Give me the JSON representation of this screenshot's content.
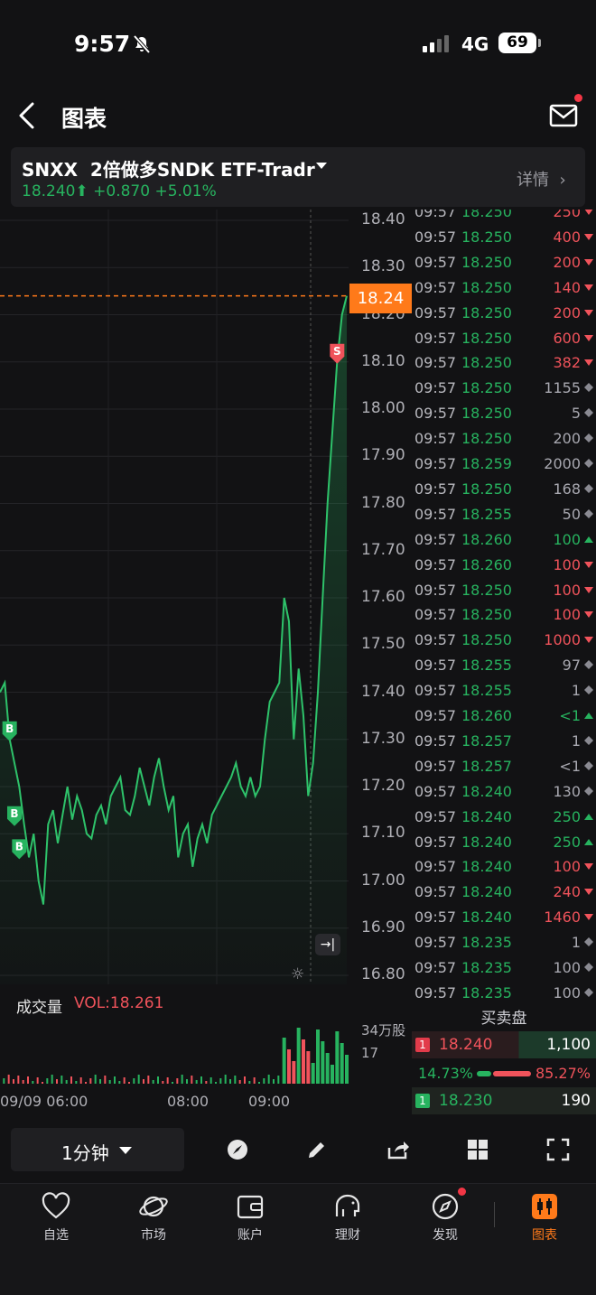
{
  "status_bar": {
    "time": "9:57",
    "network": "4G",
    "battery": "69"
  },
  "header": {
    "title": "图表"
  },
  "stock": {
    "symbol": "SNXX",
    "name": "2倍做多SNDK ETF-Tradr",
    "price": "18.240",
    "change": "+0.870",
    "change_pct": "+5.01%",
    "detail_label": "详情"
  },
  "chart_data": {
    "type": "line",
    "y_ticks": [
      "18.40",
      "18.30",
      "18.20",
      "18.10",
      "18.00",
      "17.90",
      "17.80",
      "17.70",
      "17.60",
      "17.50",
      "17.40",
      "17.30",
      "17.20",
      "17.10",
      "17.00",
      "16.90",
      "16.80"
    ],
    "ylim": [
      16.8,
      18.4
    ],
    "x_ticks": [
      "09/09 06:00",
      "08:00",
      "09:00"
    ],
    "last_price_label": "18.24",
    "series": [
      {
        "values": [
          17.4,
          17.42,
          17.3,
          17.25,
          17.2,
          17.12,
          17.05,
          17.1,
          17.0,
          16.95,
          17.12,
          17.15,
          17.08,
          17.14,
          17.2,
          17.13,
          17.18,
          17.15,
          17.1,
          17.09,
          17.14,
          17.16,
          17.12,
          17.18,
          17.2,
          17.22,
          17.15,
          17.14,
          17.18,
          17.24,
          17.2,
          17.16,
          17.22,
          17.26,
          17.2,
          17.15,
          17.18,
          17.05,
          17.1,
          17.12,
          17.03,
          17.09,
          17.12,
          17.08,
          17.14,
          17.16,
          17.18,
          17.2,
          17.22,
          17.25,
          17.2,
          17.18,
          17.22,
          17.18,
          17.2,
          17.3,
          17.38,
          17.4,
          17.42,
          17.6,
          17.55,
          17.3,
          17.45,
          17.35,
          17.18,
          17.25,
          17.4,
          17.6,
          17.8,
          17.95,
          18.1,
          18.2,
          18.24
        ]
      }
    ],
    "markers": [
      {
        "label": "B",
        "index": 2,
        "value": 17.3
      },
      {
        "label": "B",
        "index": 3,
        "value": 17.12
      },
      {
        "label": "B",
        "index": 4,
        "value": 17.05
      },
      {
        "label": "S",
        "index": 70,
        "value": 18.1
      }
    ]
  },
  "volume": {
    "label": "成交量",
    "vol_value": "VOL:18.261",
    "axis_top": "34万股",
    "axis_mid": "17"
  },
  "trades": [
    {
      "time": "09:57",
      "price": "18.250",
      "vol": "250",
      "dir": "down"
    },
    {
      "time": "09:57",
      "price": "18.250",
      "vol": "400",
      "dir": "down"
    },
    {
      "time": "09:57",
      "price": "18.250",
      "vol": "200",
      "dir": "down"
    },
    {
      "time": "09:57",
      "price": "18.250",
      "vol": "140",
      "dir": "down"
    },
    {
      "time": "09:57",
      "price": "18.250",
      "vol": "200",
      "dir": "down"
    },
    {
      "time": "09:57",
      "price": "18.250",
      "vol": "600",
      "dir": "down"
    },
    {
      "time": "09:57",
      "price": "18.250",
      "vol": "382",
      "dir": "down"
    },
    {
      "time": "09:57",
      "price": "18.250",
      "vol": "1155",
      "dir": "neutral"
    },
    {
      "time": "09:57",
      "price": "18.250",
      "vol": "5",
      "dir": "neutral"
    },
    {
      "time": "09:57",
      "price": "18.250",
      "vol": "200",
      "dir": "neutral"
    },
    {
      "time": "09:57",
      "price": "18.259",
      "vol": "2000",
      "dir": "neutral"
    },
    {
      "time": "09:57",
      "price": "18.250",
      "vol": "168",
      "dir": "neutral"
    },
    {
      "time": "09:57",
      "price": "18.255",
      "vol": "50",
      "dir": "neutral"
    },
    {
      "time": "09:57",
      "price": "18.260",
      "vol": "100",
      "dir": "up"
    },
    {
      "time": "09:57",
      "price": "18.260",
      "vol": "100",
      "dir": "down"
    },
    {
      "time": "09:57",
      "price": "18.250",
      "vol": "100",
      "dir": "down"
    },
    {
      "time": "09:57",
      "price": "18.250",
      "vol": "100",
      "dir": "down"
    },
    {
      "time": "09:57",
      "price": "18.250",
      "vol": "1000",
      "dir": "down"
    },
    {
      "time": "09:57",
      "price": "18.255",
      "vol": "97",
      "dir": "neutral"
    },
    {
      "time": "09:57",
      "price": "18.255",
      "vol": "1",
      "dir": "neutral"
    },
    {
      "time": "09:57",
      "price": "18.260",
      "vol": "<1",
      "dir": "up"
    },
    {
      "time": "09:57",
      "price": "18.257",
      "vol": "1",
      "dir": "neutral"
    },
    {
      "time": "09:57",
      "price": "18.257",
      "vol": "<1",
      "dir": "neutral"
    },
    {
      "time": "09:57",
      "price": "18.240",
      "vol": "130",
      "dir": "neutral"
    },
    {
      "time": "09:57",
      "price": "18.240",
      "vol": "250",
      "dir": "up"
    },
    {
      "time": "09:57",
      "price": "18.240",
      "vol": "250",
      "dir": "up"
    },
    {
      "time": "09:57",
      "price": "18.240",
      "vol": "100",
      "dir": "down"
    },
    {
      "time": "09:57",
      "price": "18.240",
      "vol": "240",
      "dir": "down"
    },
    {
      "time": "09:57",
      "price": "18.240",
      "vol": "1460",
      "dir": "down"
    },
    {
      "time": "09:57",
      "price": "18.235",
      "vol": "1",
      "dir": "neutral"
    },
    {
      "time": "09:57",
      "price": "18.235",
      "vol": "100",
      "dir": "neutral"
    },
    {
      "time": "09:57",
      "price": "18.235",
      "vol": "100",
      "dir": "neutral"
    }
  ],
  "order_book": {
    "title": "买卖盘",
    "ask": {
      "level": "1",
      "price": "18.240",
      "size": "1,100"
    },
    "bid": {
      "level": "1",
      "price": "18.230",
      "size": "190"
    },
    "bid_pct": "14.73%",
    "ask_pct": "85.27%"
  },
  "toolbar": {
    "interval": "1分钟"
  },
  "tabbar": [
    {
      "label": "自选",
      "icon": "heart-icon"
    },
    {
      "label": "市场",
      "icon": "planet-icon"
    },
    {
      "label": "账户",
      "icon": "wallet-icon"
    },
    {
      "label": "理财",
      "icon": "piggy-icon"
    },
    {
      "label": "发现",
      "icon": "compass-icon"
    },
    {
      "label": "图表",
      "icon": "candlestick-icon"
    }
  ],
  "colors": {
    "up": "#27b35f",
    "down": "#f0535b",
    "accent": "#ff7a1a",
    "background": "#121214"
  }
}
